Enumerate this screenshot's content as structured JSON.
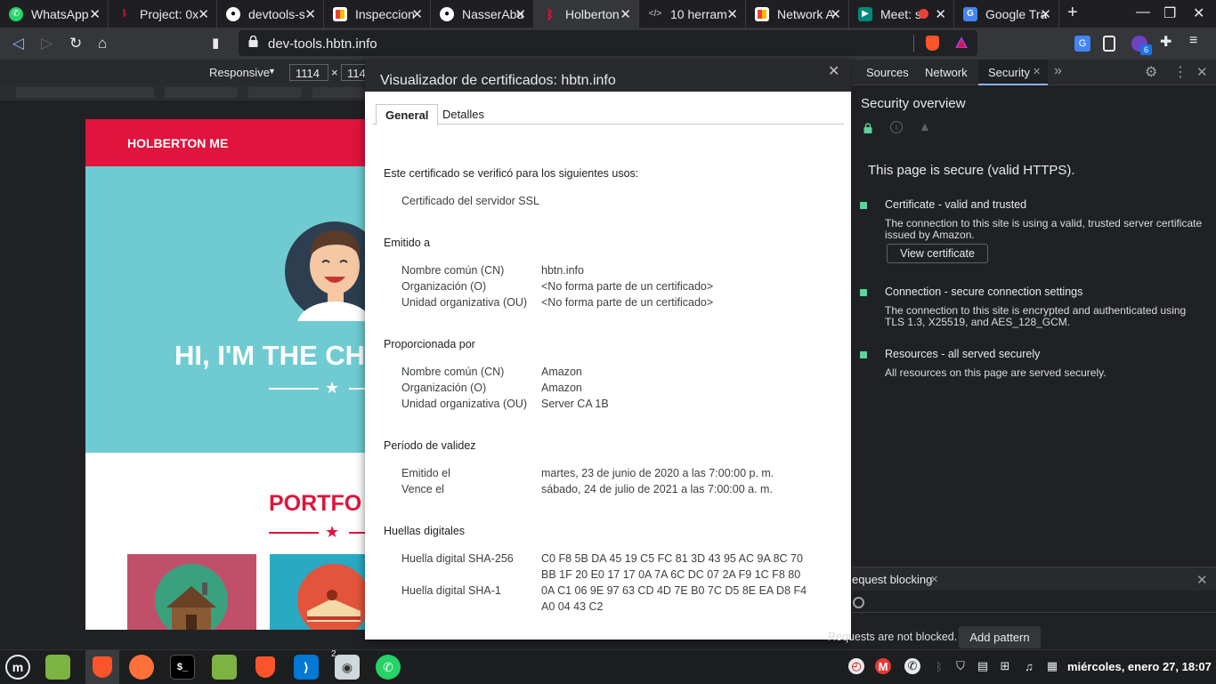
{
  "browser": {
    "tabs": [
      {
        "label": "WhatsApp",
        "icon": "whatsapp-icon",
        "color": "#25d366"
      },
      {
        "label": "Project: 0x",
        "icon": "holberton-icon",
        "color": "#e0143c"
      },
      {
        "label": "devtools-s",
        "icon": "github-icon",
        "color": "#ffffff"
      },
      {
        "label": "Inspeccion",
        "icon": "google-docs-icon",
        "color": "#4285f4"
      },
      {
        "label": "NasserAbu",
        "icon": "github-icon",
        "color": "#ffffff"
      },
      {
        "label": "Holberton",
        "icon": "holberton-icon",
        "color": "#e0143c"
      },
      {
        "label": "10 herram",
        "icon": "code-icon",
        "color": "#9aa0a6"
      },
      {
        "label": "Network A",
        "icon": "google-docs-icon",
        "color": "#4285f4"
      },
      {
        "label": "Meet: s",
        "icon": "meet-icon",
        "color": "#00897b"
      },
      {
        "label": "Google Tra",
        "icon": "google-translate-icon",
        "color": "#4285f4"
      }
    ],
    "url": "dev-tools.hbtn.info"
  },
  "device_toolbar": {
    "mode": "Responsive",
    "width": "1114",
    "times": "×",
    "height": "114"
  },
  "preview": {
    "brand": "HOLBERTON ME",
    "hero_title": "HI, I'M THE CH",
    "portfolio_title": "PORTFO"
  },
  "dialog": {
    "title": "Visualizador de certificados: hbtn.info",
    "tabs": [
      "General",
      "Detalles"
    ],
    "usage_heading": "Este certificado se verificó para los siguientes usos:",
    "usage_item": "Certificado del servidor SSL",
    "issued_to": {
      "heading": "Emitido a",
      "rows": [
        {
          "label": "Nombre común (CN)",
          "value": "hbtn.info"
        },
        {
          "label": "Organización (O)",
          "value": "<No forma parte de un certificado>"
        },
        {
          "label": "Unidad organizativa (OU)",
          "value": "<No forma parte de un certificado>"
        }
      ]
    },
    "issued_by": {
      "heading": "Proporcionada por",
      "rows": [
        {
          "label": "Nombre común (CN)",
          "value": "Amazon"
        },
        {
          "label": "Organización (O)",
          "value": "Amazon"
        },
        {
          "label": "Unidad organizativa (OU)",
          "value": "Server CA 1B"
        }
      ]
    },
    "validity": {
      "heading": "Período de validez",
      "rows": [
        {
          "label": "Emitido el",
          "value": "martes, 23 de junio de 2020 a las 7:00:00 p. m."
        },
        {
          "label": "Vence el",
          "value": "sábado, 24 de julio de 2021 a las 7:00:00 a. m."
        }
      ]
    },
    "fingerprints": {
      "heading": "Huellas digitales",
      "sha256_label": "Huella digital SHA-256",
      "sha256_line1": "C0 F8 5B DA 45 19 C5 FC 81 3D 43 95 AC 9A 8C 70",
      "sha256_line2": "BB 1F 20 E0 17 17 0A 7A 6C DC 07 2A F9 1C F8 80",
      "sha1_label": "Huella digital SHA-1",
      "sha1_line1": "0A C1 06 9E 97 63 CD 4D 7E B0 7C D5 8E EA D8 F4",
      "sha1_line2": "A0 04 43 C2"
    }
  },
  "devtools": {
    "tabs": [
      "Sources",
      "Network",
      "Security"
    ],
    "active_tab": "Security",
    "overview_title": "Security overview",
    "secure_message": "This page is secure (valid HTTPS).",
    "items": [
      {
        "title": "Certificate - valid and trusted",
        "desc": "The connection to this site is using a valid, trusted server certificate issued by Amazon."
      },
      {
        "title": "Connection - secure connection settings",
        "desc": "The connection to this site is encrypted and authenticated using TLS 1.3, X25519, and AES_128_GCM."
      },
      {
        "title": "Resources - all served securely",
        "desc": "All resources on this page are served securely."
      }
    ],
    "view_certificate": "View certificate",
    "drawer_tab": "equest blocking",
    "drawer_message": "Requests are not blocked.",
    "add_pattern": "Add pattern",
    "accent": "#8ab4f8",
    "secure_color": "#5bd39b"
  },
  "taskbar": {
    "clock": "miércoles, enero 27, 18:07",
    "badge": "2"
  }
}
